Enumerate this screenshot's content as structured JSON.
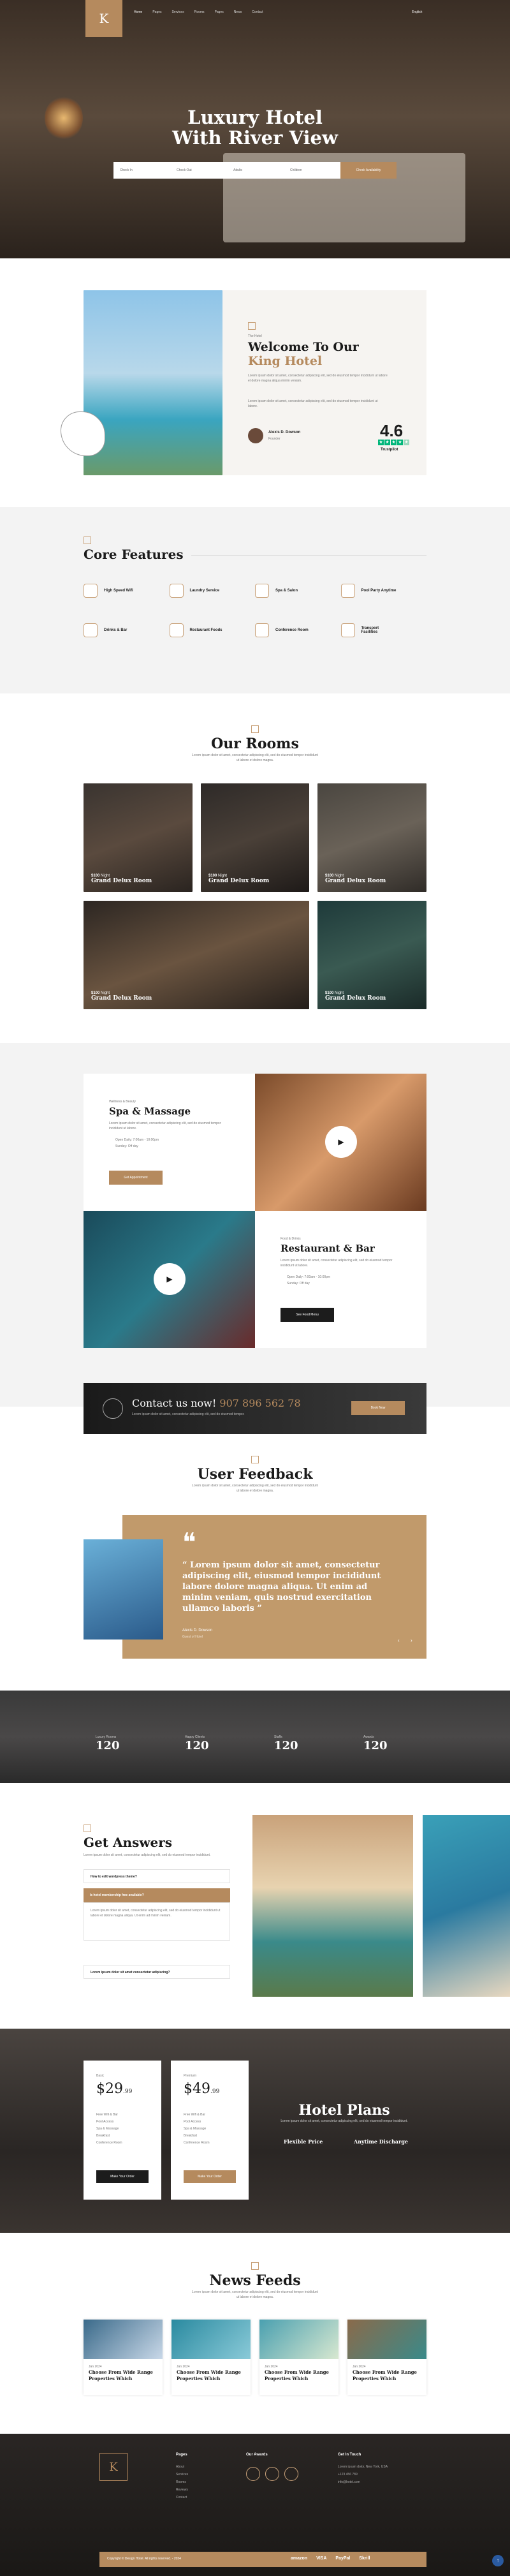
{
  "nav": {
    "items": [
      "Home",
      "Pages",
      "Services",
      "Rooms",
      "Pages",
      "News",
      "Contact"
    ],
    "lang": "English"
  },
  "hero": {
    "title_line1": "Luxury Hotel",
    "title_line2": "With River View",
    "fields": [
      "Check In",
      "Check Out",
      "Adults",
      "Children"
    ],
    "button": "Check Availability"
  },
  "welcome": {
    "subtitle": "The Hotel",
    "title1": "Welcome To Our",
    "title2": "King Hotel",
    "text1": "Lorem ipsum dolor sit amet, consectetur adipiscing elit, sed do eiusmod tempor incididunt ut labore et dolore magna aliqua minim veniam.",
    "text2": "Lorem ipsum dolor sit amet, consectetur adipiscing elit, sed do eiusmod tempor incididunt ut labore.",
    "author": "Alexis D. Dowson",
    "role": "Founder",
    "rating": "4.6",
    "trust": "Trustpilot"
  },
  "features": {
    "title": "Core Features",
    "items": [
      "High Speed Wifi",
      "Laundry Service",
      "Spa & Salon",
      "Pool Party Anytime",
      "Drinks & Bar",
      "Restaurant Foods",
      "Conference Room",
      "Transport Facilities"
    ]
  },
  "rooms": {
    "title": "Our Rooms",
    "sub": "Lorem ipsum dolor sit amet, consectetur adipiscing elit, sed do eiusmod tempor incididunt ut labore et dolore magna.",
    "items": [
      {
        "price": "$100",
        "unit": "Night",
        "name": "Grand Delux Room"
      },
      {
        "price": "$100",
        "unit": "Night",
        "name": "Grand Delux Room"
      },
      {
        "price": "$100",
        "unit": "Night",
        "name": "Grand Delux Room"
      },
      {
        "price": "$100",
        "unit": "Night",
        "name": "Grand Delux Room"
      },
      {
        "price": "$100",
        "unit": "Night",
        "name": "Grand Delux Room"
      }
    ]
  },
  "spa": {
    "sub": "Wellness & Beauty",
    "title": "Spa & Massage",
    "text": "Lorem ipsum dolor sit amet, consectetur adipiscing elit, sed do eiusmod tempor incididunt ut labore.",
    "time": "Open Daily: 7:00am - 10:00pm",
    "day": "Sunday: Off day",
    "button": "Get Appointment"
  },
  "bar": {
    "sub": "Food & Drinks",
    "title": "Restaurant & Bar",
    "text": "Lorem ipsum dolor sit amet, consectetur adipiscing elit, sed do eiusmod tempor incididunt ut labore.",
    "time": "Open Daily: 7:00am - 10:00pm",
    "day": "Sunday: Off day",
    "button": "See Food Menu"
  },
  "contact": {
    "label": "Contact us now!",
    "phone": "907 896 562 78",
    "text": "Lorem ipsum dolor sit amet, consectetur adipiscing elit, sed do eiusmod tempor.",
    "button": "Book Now"
  },
  "feedback": {
    "title": "User Feedback",
    "sub": "Lorem ipsum dolor sit amet, consectetur adipiscing elit, sed do eiusmod tempor incididunt ut labore et dolore magna.",
    "quote": "“ Lorem ipsum dolor sit amet, consectetur adipiscing elit, eiusmod tempor incididunt labore dolore magna aliqua. Ut enim ad minim veniam, quis nostrud exercitation ullamco laboris ”",
    "author": "Alexis D. Dowson",
    "role": "Guest of Hotel"
  },
  "stats": [
    {
      "label": "Luxury Rooms",
      "value": "120"
    },
    {
      "label": "Happy Clients",
      "value": "120"
    },
    {
      "label": "Staffs",
      "value": "120"
    },
    {
      "label": "Awards",
      "value": "120"
    }
  ],
  "faq": {
    "title": "Get Answers",
    "sub": "Lorem ipsum dolor sit amet, consectetur adipiscing elit, sed do eiusmod tempor incididunt.",
    "items": [
      "How to edit wordpress theme?",
      "Is hotel membership free available?",
      "Lorem ipsum dolor sit amet consectetur adipiscing?"
    ],
    "answer": "Lorem ipsum dolor sit amet, consectetur adipiscing elit, sed do eiusmod tempor incididunt ut labore et dolore magna aliqua. Ut enim ad minim veniam."
  },
  "plans": {
    "title": "Hotel Plans",
    "sub": "Lorem ipsum dolor sit amet, consectetur adipiscing elit, sed do eiusmod tempor incididunt.",
    "cards": [
      {
        "name": "Basic",
        "price": "29",
        "cents": ".99",
        "button": "Make Your Order",
        "features": [
          "Free Wifi & Bar",
          "Pool Access",
          "Spa & Massage",
          "Breakfast",
          "Conference Room"
        ]
      },
      {
        "name": "Premium",
        "price": "49",
        "cents": ".99",
        "button": "Make Your Order",
        "features": [
          "Free Wifi & Bar",
          "Pool Access",
          "Spa & Massage",
          "Breakfast",
          "Conference Room"
        ]
      }
    ],
    "f1": "Flexible Price",
    "f2": "Anytime Discharge"
  },
  "news": {
    "title": "News Feeds",
    "sub": "Lorem ipsum dolor sit amet, consectetur adipiscing elit, sed do eiusmod tempor incididunt ut labore et dolore magna.",
    "items": [
      {
        "date": "Jan 2024",
        "title": "Choose From Wide Range Properties Which"
      },
      {
        "date": "Jan 2024",
        "title": "Choose From Wide Range Properties Which"
      },
      {
        "date": "Jan 2024",
        "title": "Choose From Wide Range Properties Which"
      },
      {
        "date": "Jan 2024",
        "title": "Choose From Wide Range Properties Which"
      }
    ]
  },
  "footer": {
    "col1": "Pages",
    "col2": "Our Awards",
    "col3": "Get In Touch",
    "links": [
      "About",
      "Services",
      "Rooms",
      "Reviews",
      "Contact"
    ],
    "addr": "Lorem ipsum dolor, New York, USA",
    "phone": "+123 456 789",
    "mail": "info@hotel.com",
    "copyright": "Copyright © Design Hotel. All rights reserved. - 2024",
    "pay": [
      "amazon",
      "VISA",
      "PayPal",
      "Skrill"
    ]
  },
  "colors": {
    "accent": "#b58a5e",
    "dark": "#1c1c1c"
  }
}
